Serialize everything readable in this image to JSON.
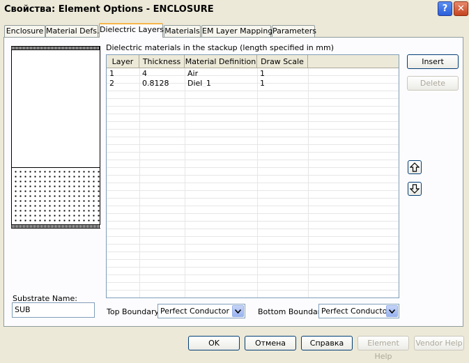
{
  "window": {
    "title": "Свойства: Element Options - ENCLOSURE"
  },
  "titlebar": {
    "help_glyph": "?",
    "close_glyph": "✕"
  },
  "tabs": [
    {
      "label": "Enclosure"
    },
    {
      "label": "Material Defs."
    },
    {
      "label": "Dielectric Layers"
    },
    {
      "label": "Materials"
    },
    {
      "label": "EM Layer Mapping"
    },
    {
      "label": "Parameters"
    }
  ],
  "active_tab": "Dielectric Layers",
  "caption": "Dielectric materials in the stackup (length specified in mm)",
  "table": {
    "columns": [
      "Layer",
      "Thickness",
      "Material Definition",
      "Draw Scale"
    ],
    "rows": [
      {
        "layer": "1",
        "thickness": "4",
        "material": "Air",
        "scale": "1"
      },
      {
        "layer": "2",
        "thickness": "0.8128",
        "material": "Diel_1",
        "scale": "1"
      }
    ]
  },
  "side_buttons": {
    "insert": "Insert",
    "delete": "Delete"
  },
  "arrow_icons": {
    "up": "arrow-up-icon",
    "down": "arrow-down-icon"
  },
  "substrate": {
    "label": "Substrate Name:",
    "value": "SUB"
  },
  "top_boundary": {
    "label": "Top Boundary:",
    "value": "Perfect Conductor"
  },
  "bottom_boundary": {
    "label": "Bottom Boundary:",
    "value": "Perfect Conductor"
  },
  "footer": {
    "ok": "OK",
    "cancel": "Отмена",
    "help": "Справка",
    "element_help": "Element Help",
    "vendor_help": "Vendor Help"
  },
  "colors": {
    "dialog_bg": "#ece9d8",
    "active_tab_accent": "#f7b64a",
    "button_border": "#003c74"
  }
}
